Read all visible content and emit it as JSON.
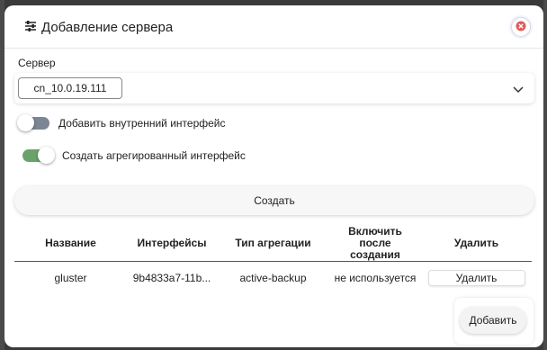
{
  "dialog": {
    "title": "Добавление сервера",
    "title_icon": "sliders-icon",
    "close_icon": "close-icon"
  },
  "server": {
    "label": "Сервер",
    "selected": "cn_10.0.19.111"
  },
  "toggles": {
    "internal_label": "Добавить внутренний интерфейс",
    "internal_on": false,
    "aggregated_label": "Создать агрегированный интерфейс",
    "aggregated_on": true
  },
  "create_label": "Создать",
  "table": {
    "headers": [
      "Название",
      "Интерфейсы",
      "Тип агрегации",
      "Включить после создания",
      "Удалить"
    ],
    "rows": [
      {
        "name": "gluster",
        "interfaces": "9b4833a7-11b...",
        "aggregation": "active-backup",
        "enable": "не используется",
        "delete_label": "Удалить"
      }
    ]
  },
  "add_label": "Добавить",
  "colors": {
    "toggle_on": "#6aa36a",
    "toggle_off": "#7b8593",
    "close_accent": "#e05a5a"
  }
}
